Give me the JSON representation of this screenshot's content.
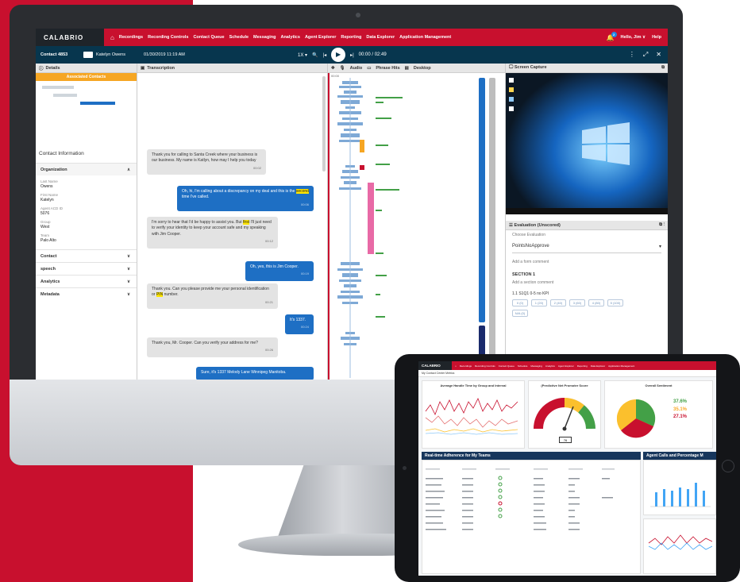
{
  "app": {
    "logo": "CALABRIO",
    "nav": [
      "Recordings",
      "Recording Controls",
      "Contact Queue",
      "Schedule",
      "Messaging",
      "Analytics",
      "Agent Explorer",
      "Reporting",
      "Data Explorer",
      "Application Management"
    ],
    "user": "Hello, Jim ∨",
    "help": "Help",
    "notification_count": "2"
  },
  "contact": {
    "id": "Contact 4853",
    "agent": "Katelyn Owens",
    "datetime": "01/30/2019  11:19 AM",
    "speed": "1X ▾",
    "time": "00:00 / 02:49"
  },
  "details": {
    "title": "Details",
    "associated": "Associated Contacts",
    "contact_info": "Contact Information",
    "organization": "Organization",
    "fields": [
      {
        "label": "Last Name",
        "value": "Owens"
      },
      {
        "label": "First Name",
        "value": "Katelyn"
      },
      {
        "label": "Agent ACD ID",
        "value": "5076"
      },
      {
        "label": "Group",
        "value": "West"
      },
      {
        "label": "Team",
        "value": "Palo Alto"
      }
    ],
    "sections": [
      "Contact",
      "speech",
      "Analytics",
      "Metadata"
    ]
  },
  "transcript": {
    "title": "Transcription",
    "messages": [
      {
        "text": "Thank you for calling to Santa Creek where your business is our business. My name is Katlyn, how may I help you today",
        "time": "00:02"
      },
      {
        "pre": "Oh, hi, I'm calling about a discrepancy on my deal and this is the ",
        "hl": "second",
        "post": " time I've called.",
        "time": "00:06"
      },
      {
        "pre": "I'm sorry to hear that I'd be happy to assist you. But ",
        "hl": "first",
        "post": " I'll just need to verify your identity to keep your account safe and my speaking with Jim Cooper.",
        "time": "00:12"
      },
      {
        "text": "Oh, yes, this is Jim Cooper.",
        "time": "00:19"
      },
      {
        "pre": "Thank you. Can you please provide me your personal identification or ",
        "hl": "PIN",
        "post": " number.",
        "time": "00:21"
      },
      {
        "text": "It's 1337.",
        "time": "00:24"
      },
      {
        "text": "Thank you, Mr. Cooper. Can you verify your address for me?",
        "time": "00:26"
      },
      {
        "text": "Sure, it's 1337 Melody Lane Winnipeg Manitoba.",
        "time": ""
      }
    ]
  },
  "audio": {
    "tabs": [
      "Audio",
      "Phrase Hits",
      "Desktop"
    ],
    "start": "00:00"
  },
  "capture": {
    "title": "Screen Capture",
    "eval_title": "Evaluation (Unscored)",
    "choose": "Choose Evaluation",
    "form": "PointsNoApprove",
    "form_comment": "Add a form comment",
    "section": "SECTION 1",
    "section_comment": "Add a section comment",
    "kpi": "1.1 S1Q1 0-5 no KPI",
    "chips": [
      "0 (0)",
      "1 (20)",
      "2 (40)",
      "3 (60)",
      "4 (80)",
      "5 (100)",
      "N/A (0)"
    ]
  },
  "tablet": {
    "subtitle": "My Contact Center Metrics",
    "cards": [
      "Average Handle Time by Group and Interval",
      "(Predictive Net Promoter Score",
      "Overall Sentiment"
    ],
    "table_title": "Real-time Adherence for My Teams",
    "side_title": "Agent Calls and Percentage M",
    "sentiment": [
      "37.6%",
      "35.1%",
      "27.1%"
    ],
    "gauge_value": "76"
  }
}
